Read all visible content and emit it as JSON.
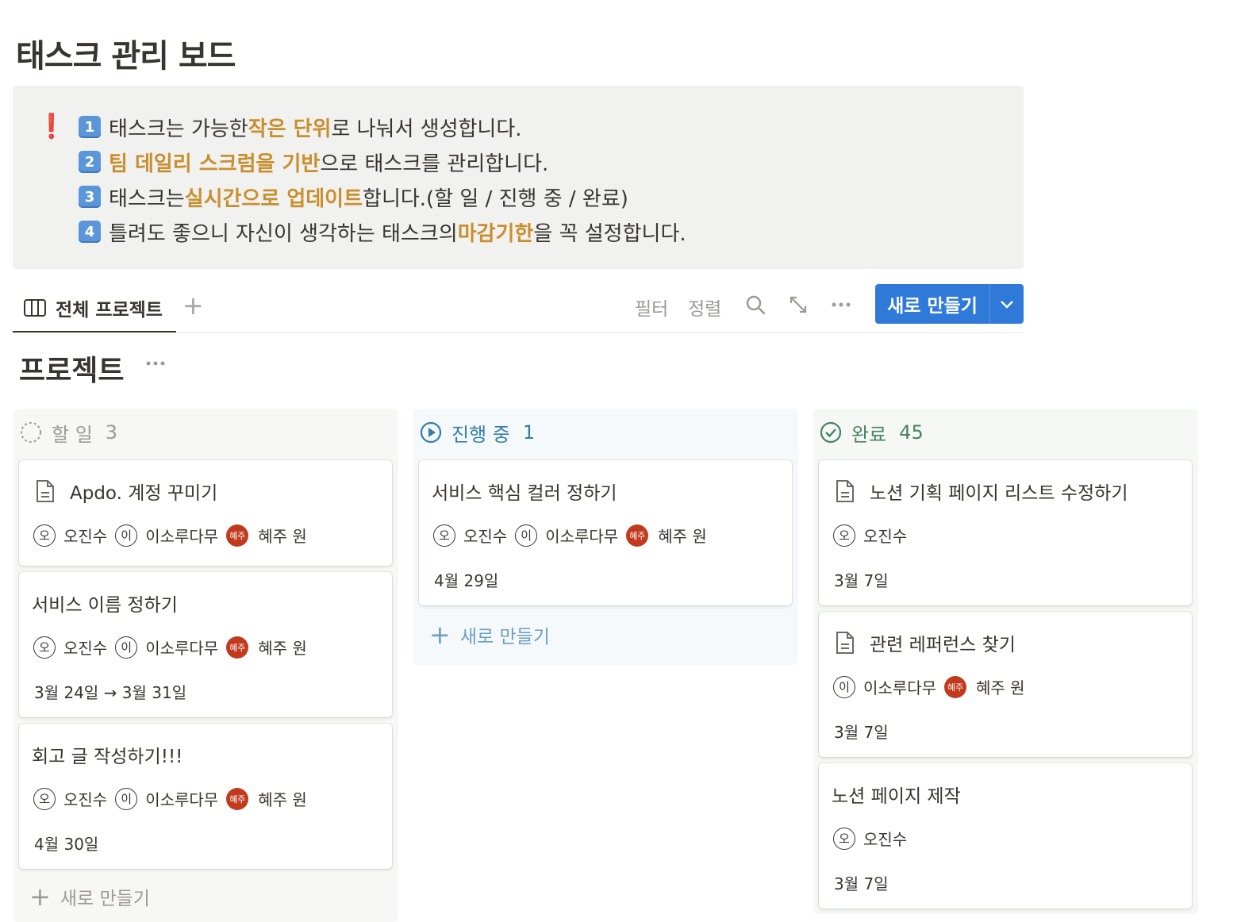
{
  "page": {
    "title": "태스크 관리 보드"
  },
  "callout": {
    "icon": "exclamation-icon",
    "lines": [
      {
        "key": "1",
        "parts": [
          "태스크는 가능한 ",
          "작은 단위",
          "로 나눠서 생성합니다."
        ]
      },
      {
        "key": "2",
        "parts": [
          "",
          "팀 데일리 스크럼을 기반",
          "으로 태스크를 관리합니다."
        ]
      },
      {
        "key": "3",
        "parts": [
          "태스크는 ",
          "실시간으로 업데이트",
          "합니다.(할 일 / 진행 중 / 완료)"
        ]
      },
      {
        "key": "4",
        "parts": [
          "틀려도 좋으니 자신이 생각하는 태스크의 ",
          "마감기한",
          "을 꼭 설정합니다."
        ]
      }
    ]
  },
  "viewbar": {
    "tab_label": "전체 프로젝트",
    "add_view": "+",
    "filter": "필터",
    "sort": "정렬",
    "new_button": "새로 만들기"
  },
  "group": {
    "title": "프로젝트"
  },
  "columns": {
    "todo": {
      "name": "할 일",
      "count": "3",
      "color": "#9b9a97",
      "add_label": "새로 만들기",
      "cards": [
        {
          "title": "Apdo. 계정 꾸미기",
          "people": [
            "오진수",
            "이소루다무",
            "혜주 원"
          ],
          "date": ""
        },
        {
          "title": "서비스 이름 정하기",
          "people": [
            "오진수",
            "이소루다무",
            "혜주 원"
          ],
          "date": "3월 24일 → 3월 31일"
        },
        {
          "title": "회고 글 작성하기!!!",
          "people": [
            "오진수",
            "이소루다무",
            "혜주 원"
          ],
          "date": "4월 30일"
        }
      ]
    },
    "progress": {
      "name": "진행 중",
      "count": "1",
      "color": "#337ea9",
      "add_label": "새로 만들기",
      "cards": [
        {
          "title": "서비스 핵심 컬러 정하기",
          "people": [
            "오진수",
            "이소루다무",
            "혜주 원"
          ],
          "date": "4월 29일"
        }
      ]
    },
    "done": {
      "name": "완료",
      "count": "45",
      "color": "#448361",
      "cards": [
        {
          "title": "노션 기획 페이지 리스트 수정하기",
          "people": [
            "오진수"
          ],
          "date": "3월 7일"
        },
        {
          "title": "관련 레퍼런스 찾기",
          "people": [
            "이소루다무",
            "혜주 원"
          ],
          "date": "3월 7일"
        },
        {
          "title": "노션 페이지 제작",
          "people": [
            "오진수"
          ],
          "date": "3월 7일"
        }
      ]
    }
  },
  "avatars": {
    "오진수": "오",
    "이소루다무": "이",
    "혜주 원": "혜주"
  }
}
